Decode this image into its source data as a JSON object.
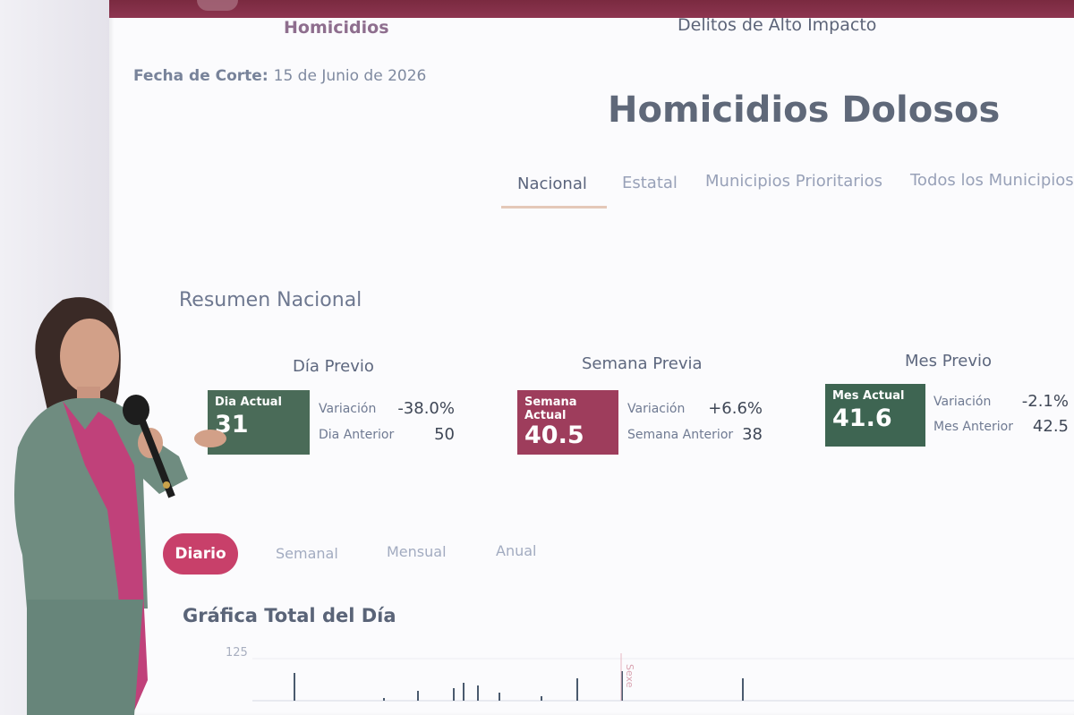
{
  "header": {
    "left_title": "Homicidios",
    "center_title": "Delitos de Alto Impacto"
  },
  "fecha": {
    "label": "Fecha de Corte:",
    "value": "15 de Junio de 2026"
  },
  "page_title": "Homicidios Dolosos",
  "tabs": [
    {
      "label": "Nacional",
      "active": true
    },
    {
      "label": "Estatal",
      "active": false
    },
    {
      "label": "Municipios Prioritarios",
      "active": false
    },
    {
      "label": "Todos los Municipios",
      "active": false
    }
  ],
  "summary": {
    "title": "Resumen Nacional",
    "cards": [
      {
        "title": "Día Previo",
        "box_label": "Dia Actual",
        "box_value": "31",
        "variation_label": "Variación",
        "variation_value": "-38.0%",
        "previous_label": "Dia Anterior",
        "previous_value": "50",
        "color": "#4a6b58"
      },
      {
        "title": "Semana Previa",
        "box_label": "Semana Actual",
        "box_value": "40.5",
        "variation_label": "Variación",
        "variation_value": "+6.6%",
        "previous_label": "Semana Anterior",
        "previous_value": "38",
        "color": "#9e3d5c"
      },
      {
        "title": "Mes Previo",
        "box_label": "Mes Actual",
        "box_value": "41.6",
        "variation_label": "Variación",
        "variation_value": "-2.1%",
        "previous_label": "Mes Anterior",
        "previous_value": "42.5",
        "color": "#3e6552"
      }
    ]
  },
  "period_tabs": [
    {
      "label": "Diario",
      "active": true
    },
    {
      "label": "Semanal",
      "active": false
    },
    {
      "label": "Mensual",
      "active": false
    },
    {
      "label": "Anual",
      "active": false
    }
  ],
  "chart": {
    "title": "Gráfica Total del Día",
    "y_tick": "125",
    "marker_label": "Sexe"
  },
  "colors": {
    "accent": "#c8406a",
    "topbar": "#7a2a40",
    "green": "#4a6b58",
    "maroon": "#9e3d5c"
  }
}
